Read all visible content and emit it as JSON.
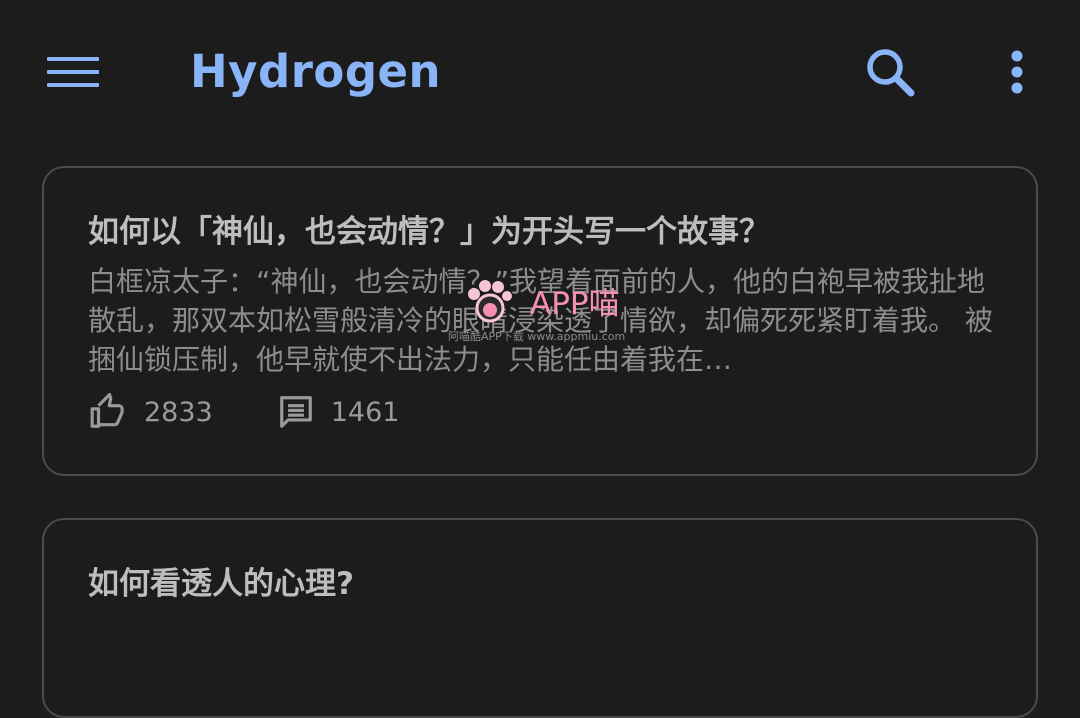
{
  "appbar": {
    "title": "Hydrogen",
    "menu_icon": "hamburger-menu-icon",
    "search_icon": "search-icon",
    "more_icon": "more-vert-icon",
    "accent_color": "#8ab4f8"
  },
  "feed": [
    {
      "title": "如何以「神仙，也会动情？」为开头写一个故事？",
      "excerpt": "白框凉太子：“神仙，也会动情？”我望着面前的人，他的白袍早被我扯地散乱，那双本如松雪般清冷的眼睛浸染透了情欲，却偏死死紧盯着我。 被捆仙锁压制，他早就使不出法力，只能任由着我在…",
      "likes": "2833",
      "comments": "1461"
    },
    {
      "title": "如何看透人的心理?"
    }
  ],
  "watermark": {
    "text": "APP喵",
    "subtext": "阿喵酷APP下载 www.appmiu.com",
    "color": "#f48fb1"
  }
}
